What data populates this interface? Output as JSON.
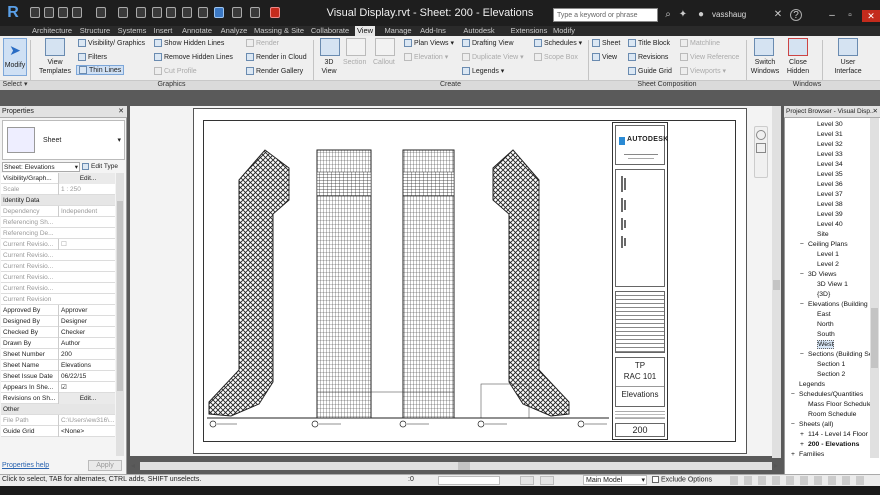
{
  "titlebar": {
    "app_logo": "R",
    "title": "Visual Display.rvt - Sheet: 200 - Elevations",
    "search_placeholder": "Type a keyword or phrase",
    "user": "vasshaug"
  },
  "tabs": [
    "Architecture",
    "Structure",
    "Systems",
    "Insert",
    "Annotate",
    "Analyze",
    "Massing & Site",
    "Collaborate",
    "View",
    "Manage",
    "Add-Ins",
    "Autodesk Seek",
    "Extensions",
    "Modify"
  ],
  "active_tab": "View",
  "ribbon": {
    "modify": "Modify",
    "select": "Select",
    "view_templates": "View Templates",
    "visibility_graphics": "Visibility/ Graphics",
    "filters": "Filters",
    "thin_lines": "Thin Lines",
    "show_hidden_lines": "Show Hidden Lines",
    "remove_hidden_lines": "Remove Hidden Lines",
    "cut_profile": "Cut Profile",
    "render": "Render",
    "render_in_cloud": "Render in Cloud",
    "render_gallery": "Render Gallery",
    "graphics_label": "Graphics",
    "view_3d": "3D View",
    "section": "Section",
    "callout": "Callout",
    "plan_views": "Plan Views",
    "elevation": "Elevation",
    "drafting_view": "Drafting View",
    "duplicate_view": "Duplicate View",
    "legends": "Legends",
    "schedules": "Schedules",
    "scope_box": "Scope Box",
    "create_label": "Create",
    "sheet": "Sheet",
    "view": "View",
    "title_block": "Title Block",
    "revisions": "Revisions",
    "guide_grid": "Guide Grid",
    "matchline": "Matchline",
    "view_reference": "View Reference",
    "viewports": "Viewports",
    "sheet_composition_label": "Sheet Composition",
    "switch_windows": "Switch Windows",
    "close_hidden": "Close Hidden",
    "user_interface": "User Interface",
    "windows_label": "Windows"
  },
  "properties": {
    "header": "Properties",
    "type_name": "Sheet",
    "selector": "Sheet: Elevations",
    "edit_type": "Edit Type",
    "help_link": "Properties help",
    "apply": "Apply",
    "rows": [
      {
        "k": "Visibility/Graph...",
        "v": "Edit...",
        "dis": false,
        "btn": true
      },
      {
        "k": "Scale",
        "v": "1 : 250",
        "dis": true
      },
      {
        "k": "Identity Data",
        "v": "",
        "group": true
      },
      {
        "k": "Dependency",
        "v": "Independent",
        "dis": true
      },
      {
        "k": "Referencing Sh...",
        "v": "",
        "dis": true
      },
      {
        "k": "Referencing De...",
        "v": "",
        "dis": true
      },
      {
        "k": "Current Revisio...",
        "v": "☐",
        "dis": true
      },
      {
        "k": "Current Revisio...",
        "v": "",
        "dis": true
      },
      {
        "k": "Current Revisio...",
        "v": "",
        "dis": true
      },
      {
        "k": "Current Revisio...",
        "v": "",
        "dis": true
      },
      {
        "k": "Current Revisio...",
        "v": "",
        "dis": true
      },
      {
        "k": "Current Revision",
        "v": "",
        "dis": true
      },
      {
        "k": "Approved By",
        "v": "Approver",
        "dis": false
      },
      {
        "k": "Designed By",
        "v": "Designer",
        "dis": false
      },
      {
        "k": "Checked By",
        "v": "Checker",
        "dis": false
      },
      {
        "k": "Drawn By",
        "v": "Author",
        "dis": false
      },
      {
        "k": "Sheet Number",
        "v": "200",
        "dis": false
      },
      {
        "k": "Sheet Name",
        "v": "Elevations",
        "dis": false
      },
      {
        "k": "Sheet Issue Date",
        "v": "06/22/15",
        "dis": false
      },
      {
        "k": "Appears In She...",
        "v": "☑",
        "dis": false
      },
      {
        "k": "Revisions on Sh...",
        "v": "Edit...",
        "dis": false,
        "btn": true
      },
      {
        "k": "Other",
        "v": "",
        "group": true
      },
      {
        "k": "File Path",
        "v": "C:\\Users\\ew316\\...",
        "dis": true
      },
      {
        "k": "Guide Grid",
        "v": "<None>",
        "dis": false
      }
    ]
  },
  "titleblock": {
    "brand": "AUTODESK",
    "project_code": "TP",
    "project_name": "RAC 101",
    "sheet_name": "Elevations",
    "sheet_number": "200"
  },
  "browser": {
    "header": "Project Browser - Visual Disp...",
    "items": [
      {
        "t": "Level 30",
        "i": 3
      },
      {
        "t": "Level 31",
        "i": 3
      },
      {
        "t": "Level 32",
        "i": 3
      },
      {
        "t": "Level 33",
        "i": 3
      },
      {
        "t": "Level 34",
        "i": 3
      },
      {
        "t": "Level 35",
        "i": 3
      },
      {
        "t": "Level 36",
        "i": 3
      },
      {
        "t": "Level 37",
        "i": 3
      },
      {
        "t": "Level 38",
        "i": 3
      },
      {
        "t": "Level 39",
        "i": 3
      },
      {
        "t": "Level 40",
        "i": 3
      },
      {
        "t": "Site",
        "i": 3
      },
      {
        "t": "Ceiling Plans",
        "i": 2,
        "tog": "−"
      },
      {
        "t": "Level 1",
        "i": 3
      },
      {
        "t": "Level 2",
        "i": 3
      },
      {
        "t": "3D Views",
        "i": 2,
        "tog": "−"
      },
      {
        "t": "3D View 1",
        "i": 3
      },
      {
        "t": "{3D}",
        "i": 3
      },
      {
        "t": "Elevations (Building El...",
        "i": 2,
        "tog": "−"
      },
      {
        "t": "East",
        "i": 3
      },
      {
        "t": "North",
        "i": 3
      },
      {
        "t": "South",
        "i": 3
      },
      {
        "t": "West",
        "i": 3,
        "sel": true
      },
      {
        "t": "Sections (Building Se...",
        "i": 2,
        "tog": "−"
      },
      {
        "t": "Section 1",
        "i": 3
      },
      {
        "t": "Section 2",
        "i": 3
      },
      {
        "t": "Legends",
        "i": 1
      },
      {
        "t": "Schedules/Quantities",
        "i": 1,
        "tog": "−"
      },
      {
        "t": "Mass Floor Schedule",
        "i": 2
      },
      {
        "t": "Room Schedule",
        "i": 2
      },
      {
        "t": "Sheets (all)",
        "i": 1,
        "tog": "−"
      },
      {
        "t": "114 - Level 14 Floor P...",
        "i": 2,
        "tog": "+"
      },
      {
        "t": "200 - Elevations",
        "i": 2,
        "tog": "+",
        "bold": true
      },
      {
        "t": "Families",
        "i": 1,
        "tog": "+"
      }
    ]
  },
  "status": {
    "hint": "Click to select, TAB for alternates, CTRL adds, SHIFT unselects.",
    "coord": ":0",
    "model": "Main Model",
    "exclude": "Exclude Options"
  }
}
